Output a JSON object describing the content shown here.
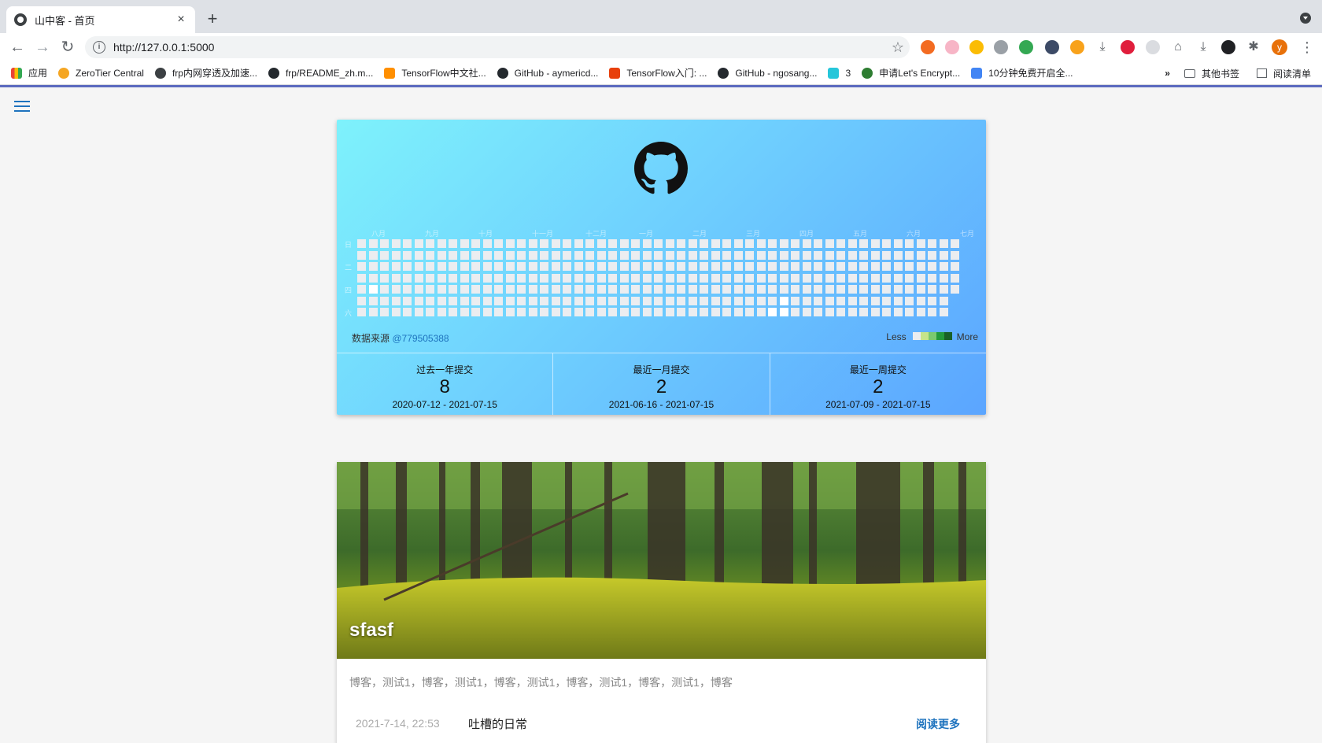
{
  "browser": {
    "tab_title": "山中客 - 首页",
    "url": "http://127.0.0.1:5000",
    "bookmarks": [
      {
        "label": "应用",
        "icon": "apps-grid-icon"
      },
      {
        "label": "ZeroTier Central",
        "icon": "zerotier-icon"
      },
      {
        "label": "frp内网穿透及加速...",
        "icon": "globe-icon"
      },
      {
        "label": "frp/README_zh.m...",
        "icon": "github-icon"
      },
      {
        "label": "TensorFlow中文社...",
        "icon": "tensorflow-icon"
      },
      {
        "label": "GitHub - aymericd...",
        "icon": "github-icon"
      },
      {
        "label": "TensorFlow入门: ...",
        "icon": "c-icon"
      },
      {
        "label": "GitHub - ngosang...",
        "icon": "github-icon"
      },
      {
        "label": "3",
        "icon": "chart-icon"
      },
      {
        "label": "申请Let's Encrypt...",
        "icon": "letsencrypt-icon"
      },
      {
        "label": "10分钟免费开启全...",
        "icon": "blue-icon"
      }
    ],
    "overflow_label": "»",
    "other_bookmarks": "其他书签",
    "reading_list": "阅读清单",
    "profile_initial": "y"
  },
  "contrib": {
    "months": [
      "八月",
      "九月",
      "十月",
      "十一月",
      "十二月",
      "一月",
      "二月",
      "三月",
      "四月",
      "五月",
      "六月",
      "七月"
    ],
    "weekdays": [
      "日",
      "二",
      "四",
      "六"
    ],
    "source_label": "数据来源",
    "source_user": "@779505388",
    "legend_less": "Less",
    "legend_more": "More",
    "legend_colors": [
      "#ebedf0",
      "#c6e48b",
      "#7bc96f",
      "#239a3b",
      "#196127"
    ],
    "weeks": 53,
    "last_week_days": 5,
    "active_cells": [
      [
        1,
        4
      ],
      [
        37,
        5
      ],
      [
        37,
        6
      ],
      [
        36,
        6
      ]
    ]
  },
  "stats": [
    {
      "label": "过去一年提交",
      "value": "8",
      "range": "2020-07-12 - 2021-07-15"
    },
    {
      "label": "最近一月提交",
      "value": "2",
      "range": "2021-06-16 - 2021-07-15"
    },
    {
      "label": "最近一周提交",
      "value": "2",
      "range": "2021-07-09 - 2021-07-15"
    }
  ],
  "post": {
    "title": "sfasf",
    "excerpt": "博客，测试1，博客，测试1，博客，测试1，博客，测试1，博客，测试1，博客",
    "date": "2021-7-14, 22:53",
    "category": "吐槽的日常",
    "read_more": "阅读更多"
  }
}
